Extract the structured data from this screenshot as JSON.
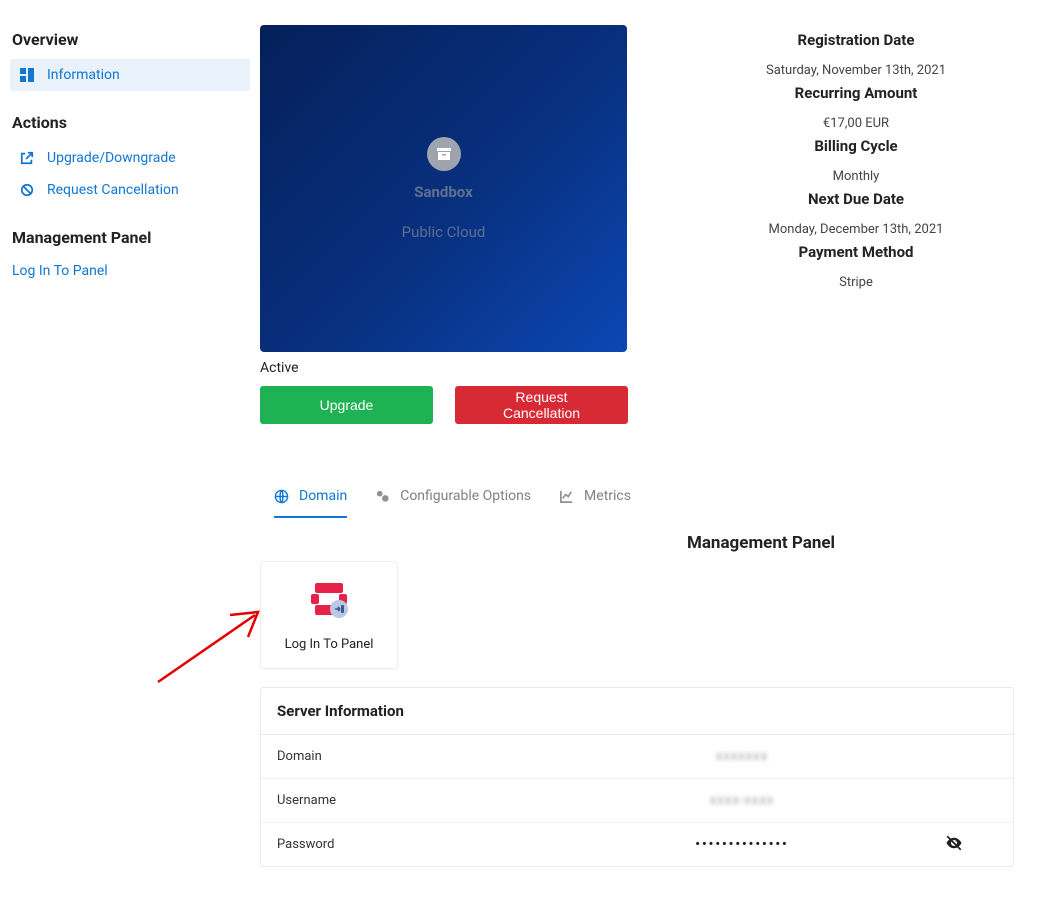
{
  "sidebar": {
    "overview_heading": "Overview",
    "information_label": "Information",
    "actions_heading": "Actions",
    "upgrade_label": "Upgrade/Downgrade",
    "cancel_label": "Request Cancellation",
    "mgmt_heading": "Management Panel",
    "login_label": "Log In To Panel"
  },
  "product": {
    "name": "Sandbox",
    "group": "Public Cloud",
    "status": "Active",
    "upgrade_btn": "Upgrade",
    "cancel_btn": "Request Cancellation"
  },
  "billing": {
    "registration_heading": "Registration Date",
    "registration_date": "Saturday, November 13th, 2021",
    "recurring_heading": "Recurring Amount",
    "recurring_amount": "€17,00 EUR",
    "cycle_heading": "Billing Cycle",
    "cycle_value": "Monthly",
    "due_heading": "Next Due Date",
    "due_value": "Monday, December 13th, 2021",
    "payment_heading": "Payment Method",
    "payment_value": "Stripe"
  },
  "tabs": {
    "domain": "Domain",
    "config": "Configurable Options",
    "metrics": "Metrics"
  },
  "mgmt_panel": {
    "title": "Management Panel",
    "tile_label": "Log In To Panel"
  },
  "server_info": {
    "heading": "Server Information",
    "domain_label": "Domain",
    "domain_value": "xxxxxxx",
    "username_label": "Username",
    "username_value": "xxxx-xxxx",
    "password_label": "Password",
    "password_value": "••••••••••••••"
  }
}
